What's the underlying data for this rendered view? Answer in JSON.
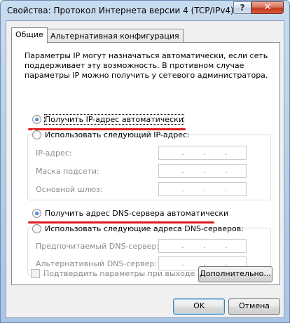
{
  "window": {
    "title": "Свойства: Протокол Интернета версии 4 (TCP/IPv4)",
    "help_glyph": "?",
    "close_glyph": "✕"
  },
  "tabs": [
    {
      "label": "Общие",
      "active": true
    },
    {
      "label": "Альтернативная конфигурация",
      "active": false
    }
  ],
  "general": {
    "description": "Параметры IP могут назначаться автоматически, если сеть поддерживает эту возможность. В противном случае параметры IP можно получить у сетевого администратора.",
    "ip_auto_label": "Получить IP-адрес автоматически",
    "ip_manual_label": "Использовать следующий IP-адрес:",
    "ip_mode_selected": "auto",
    "ip_fields": {
      "ip_address_label": "IP-адрес:",
      "subnet_mask_label": "Маска подсети:",
      "gateway_label": "Основной шлюз:",
      "empty_value": ".  .  ."
    },
    "dns_auto_label": "Получить адрес DNS-сервера автоматически",
    "dns_manual_label": "Использовать следующие адреса DNS-серверов:",
    "dns_mode_selected": "auto",
    "dns_fields": {
      "preferred_label": "Предпочитаемый DNS-сервер:",
      "alternate_label": "Альтернативный DNS-сервер:"
    },
    "validate_on_exit_label": "Подтвердить параметры при выходе",
    "validate_on_exit_checked": false,
    "advanced_button": "Дополнительно..."
  },
  "footer": {
    "ok_button": "OK",
    "cancel_button": "Отмена"
  },
  "colors": {
    "highlight_underline": "#e11b1b",
    "radio_selected": "#1d61c4",
    "disabled_text": "#8d8d8d"
  },
  "icons": {
    "help": "help-icon",
    "close": "close-icon"
  }
}
